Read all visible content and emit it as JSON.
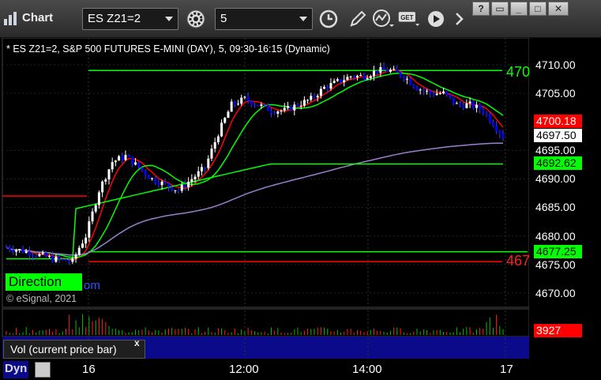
{
  "app": {
    "title": "Chart"
  },
  "toolbar": {
    "symbol": "ES Z21=2",
    "interval": "5"
  },
  "chart": {
    "info": "* ES Z21=2, S&P 500 FUTURES E-MINI (DAY), 5, 09:30-16:15 (Dynamic)",
    "direction_label": "Direction",
    "com_text": "om",
    "copyright": "© eSignal, 2021",
    "right_line_top": "470",
    "right_line_bottom": "467",
    "axis_prices": [
      "4710.00",
      "4705.00",
      "4695.00",
      "4690.00",
      "4685.00",
      "4680.00",
      "4675.00",
      "4670.00"
    ],
    "tags": {
      "red_price": "4700.18",
      "last_price": "4697.50",
      "green_upper": "4692.62",
      "green_lower": "4677.25",
      "volume": "3927"
    },
    "vol_study": "Vol (current price bar)",
    "vol_close": "x",
    "bottom_label": "Dyn",
    "time_labels": [
      "16",
      "12:00",
      "14:00",
      "17"
    ],
    "colors": {
      "bull_candle": "#ffffff",
      "bear_candle": "#0000ff",
      "ema_red": "#ff0000",
      "ma_green": "#00ff00",
      "ma_purple": "#9a80d0",
      "level_green": "#00ff00",
      "level_red": "#ff0000"
    }
  },
  "chart_data": {
    "type": "candlestick",
    "price_levels": {
      "upper_green": 4709,
      "mid_green": 4692.62,
      "lower_green": 4677.25,
      "lower_red": 4675.5,
      "left_red": 4687,
      "last": 4697.5,
      "red_ema_end": 4700.18
    },
    "ylim": [
      4667,
      4713
    ],
    "y_ticks": [
      4710,
      4705,
      4695,
      4690,
      4685,
      4680,
      4675,
      4670
    ]
  }
}
